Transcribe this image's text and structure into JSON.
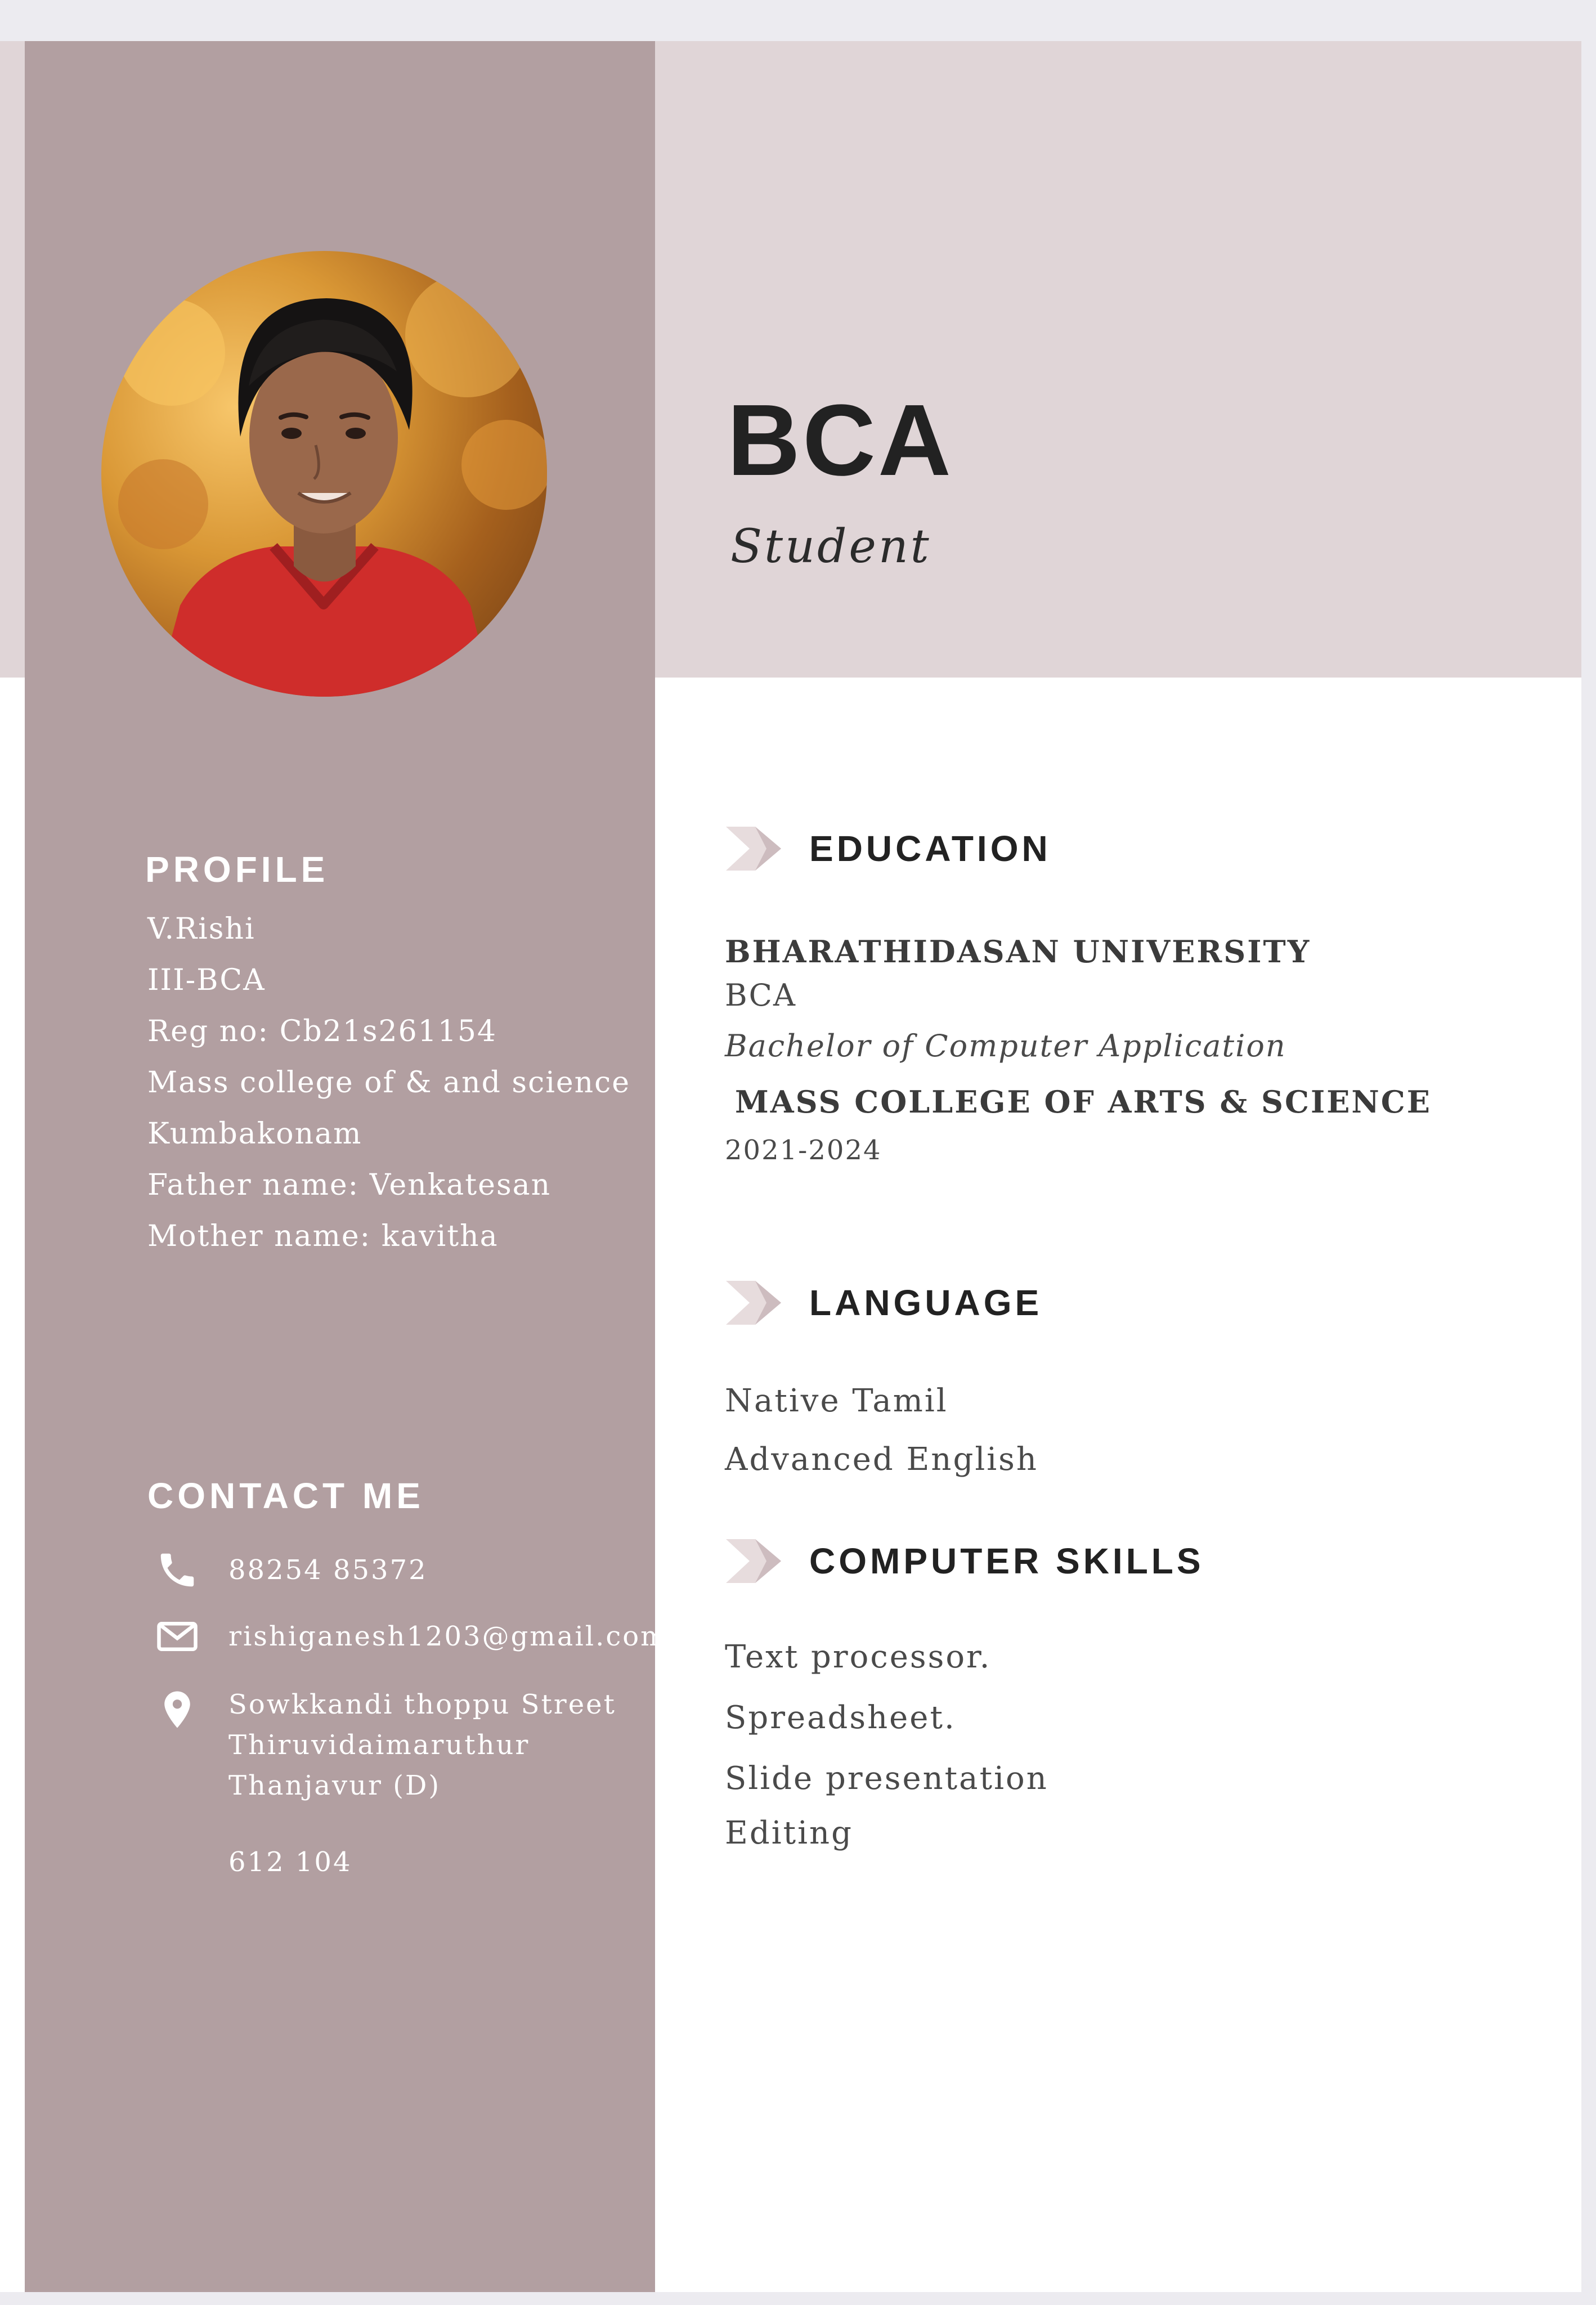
{
  "header": {
    "title": "BCA",
    "subtitle": "Student"
  },
  "profile": {
    "heading": "PROFILE",
    "lines": [
      "V.Rishi",
      "III-BCA",
      "Reg no: Cb21s261154",
      "Mass college of & and science",
      "Kumbakonam",
      "Father name: Venkatesan",
      "Mother name: kavitha"
    ]
  },
  "contact": {
    "heading": "CONTACT ME",
    "phone": "88254 85372",
    "email": "rishiganesh1203@gmail.com",
    "address": {
      "lines": [
        "Sowkkandi thoppu Street",
        "Thiruvidaimaruthur",
        "Thanjavur (D)"
      ],
      "postal_code": "612 104"
    },
    "icons": {
      "phone": "phone-icon",
      "email": "envelope-icon",
      "address": "location-pin-icon"
    }
  },
  "education": {
    "heading": "EDUCATION",
    "institution_1": "BHARATHIDASAN UNIVERSITY",
    "degree_short": "BCA",
    "degree_full": "Bachelor of Computer Application",
    "institution_2": "MASS COLLEGE OF ARTS & SCIENCE",
    "years": "2021-2024"
  },
  "language": {
    "heading": "LANGUAGE",
    "items": [
      "Native Tamil",
      "Advanced English"
    ]
  },
  "computer_skills": {
    "heading": "COMPUTER SKILLS",
    "items": [
      "Text processor.",
      "Spreadsheet.",
      "Slide presentation",
      "Editing"
    ]
  },
  "colors": {
    "sidebar": "#b29fa1",
    "hero_band": "#e0d5d7",
    "page": "#ffffff",
    "outer_background": "#ecebf0",
    "dark_text": "#222222",
    "light_text": "#ffffff",
    "chevron_light": "#e7dcdd",
    "chevron_dark": "#cdbcbf"
  }
}
